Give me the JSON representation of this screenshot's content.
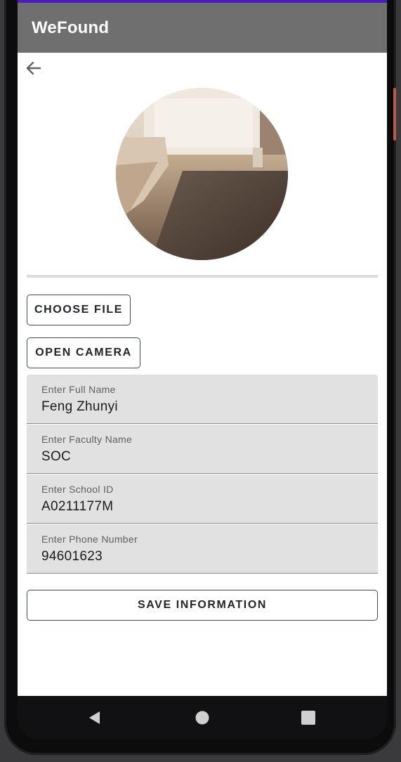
{
  "app": {
    "title": "WeFound"
  },
  "colors": {
    "status_bar": "#4a1cb8",
    "app_bar": "#6f6f6f",
    "field_bg": "#e1e1e1",
    "outline": "#3f4c55"
  },
  "icons": {
    "back": "arrow-back-icon",
    "nav_back": "triangle-back-icon",
    "nav_home": "circle-home-icon",
    "nav_recents": "square-recents-icon"
  },
  "buttons": {
    "choose_file": "CHOOSE FILE",
    "open_camera": "OPEN CAMERA",
    "save": "SAVE INFORMATION"
  },
  "form": {
    "fields": [
      {
        "label": "Enter Full Name",
        "value": "Feng Zhunyi"
      },
      {
        "label": "Enter Faculty Name",
        "value": "SOC"
      },
      {
        "label": "Enter School ID",
        "value": "A0211177M"
      },
      {
        "label": "Enter Phone Number",
        "value": "94601623"
      }
    ]
  }
}
